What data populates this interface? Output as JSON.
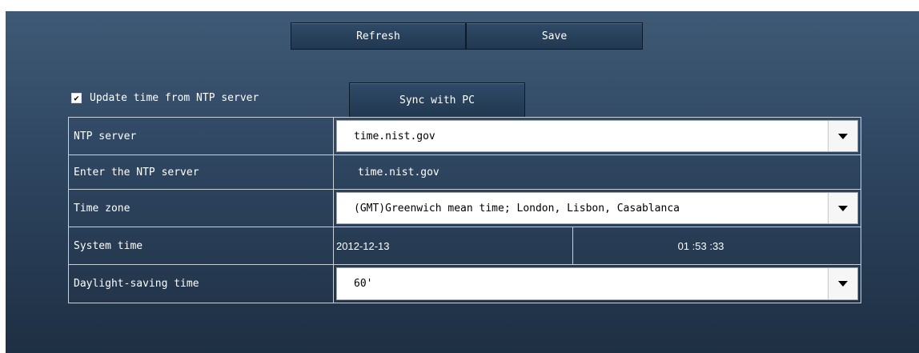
{
  "toolbar": {
    "refresh_label": "Refresh",
    "save_label": "Save"
  },
  "ntp_update": {
    "checked": true,
    "check_mark": "✔",
    "label": "Update time from NTP server",
    "sync_label": "Sync with PC"
  },
  "settings": {
    "ntp_server": {
      "label": "NTP server",
      "value": "time.nist.gov"
    },
    "enter_ntp_server": {
      "label": "Enter the NTP server",
      "value": "time.nist.gov"
    },
    "time_zone": {
      "label": "Time zone",
      "value": "(GMT)Greenwich mean time; London, Lisbon, Casablanca"
    },
    "system_time": {
      "label": "System time",
      "date": "2012-12-13",
      "time": "01 :53 :33"
    },
    "daylight_saving": {
      "label": "Daylight-saving time",
      "value": "60'"
    }
  },
  "icons": {
    "dropdown": "chevron-down-icon",
    "checkbox": "check-icon"
  },
  "colors": {
    "panel_top": "#3f5a76",
    "panel_bottom": "#1e2f43",
    "button": "#2a4460",
    "grid_line": "#c8d0d8",
    "text": "#ffffff"
  }
}
